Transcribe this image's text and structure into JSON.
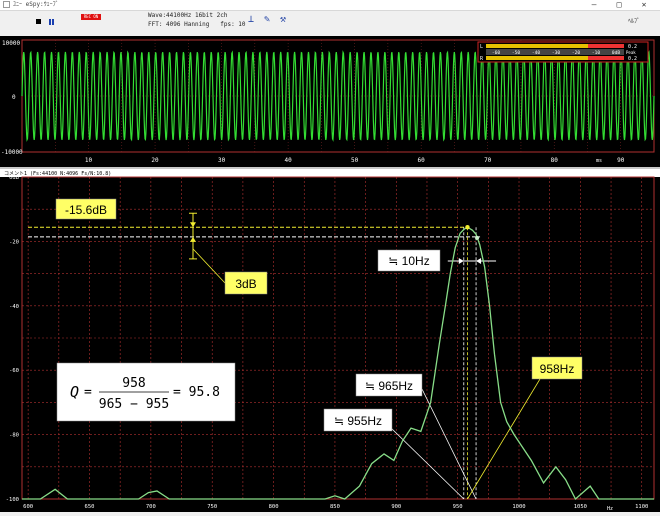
{
  "window": {
    "title": "ﾕﾆｰ eSpy:ｳｪｰﾌﾞ",
    "min_label": "—",
    "max_label": "□",
    "close_label": "✕"
  },
  "toolbar": {
    "record_label": "REC ON",
    "wave_info": "Wave:44100Hz 16bit 2ch",
    "fft_info": "FFT: 4096 Hanning   fps: 10",
    "tool1_icon": "bars-icon",
    "tool2_icon": "pen-icon",
    "tool3_icon": "wrench-icon",
    "right_label": "ﾍﾙﾌﾟ"
  },
  "waveform": {
    "y_ticks": [
      "10000",
      "0",
      "-10000"
    ],
    "x_ticks": [
      "10",
      "20",
      "30",
      "40",
      "50",
      "60",
      "70",
      "80",
      "90"
    ],
    "x_unit": "ms",
    "line_color": "#33dd33",
    "meter": {
      "left_label": "L",
      "right_label": "R",
      "scale": [
        "-60",
        "-50",
        "-40",
        "-30",
        "-20",
        "-10",
        "0dB"
      ],
      "peak_label": "Peak",
      "left_value": "0.2",
      "right_value": "0.2"
    }
  },
  "spectrum": {
    "header": "コメント1   (Fs:44100 N:4096 Fs/N:10.8)",
    "y_ticks": [
      "0dB",
      "-20",
      "-40",
      "-60",
      "-80",
      "-100"
    ],
    "x_ticks": [
      "600",
      "650",
      "700",
      "750",
      "800",
      "850",
      "900",
      "950",
      "1000",
      "1050",
      "1100"
    ],
    "x_unit": "Hz",
    "line_color": "#88dd88",
    "grid_color": "#b03030"
  },
  "chart_data": {
    "type": "line",
    "xlabel": "Hz",
    "ylabel": "",
    "xlim": [
      595,
      1110
    ],
    "ylim": [
      -100,
      0
    ],
    "series": [
      {
        "x": [
          595,
          610,
          622,
          632,
          690,
          698,
          705,
          715,
          735,
          770,
          790,
          842,
          850,
          858,
          870,
          880,
          890,
          898,
          905,
          912,
          920,
          928,
          935,
          940,
          944,
          948,
          952,
          955,
          958,
          962,
          965,
          968,
          972,
          976,
          980,
          985,
          990,
          996,
          1003,
          1010,
          1020,
          1030,
          1038,
          1046,
          1058,
          1065,
          1080,
          1095,
          1110
        ],
        "y": [
          -100,
          -100,
          -97,
          -100,
          -100,
          -98,
          -97.5,
          -100,
          -100,
          -100,
          -100,
          -100,
          -99,
          -100,
          -96,
          -89,
          -86,
          -88,
          -82,
          -78,
          -79,
          -70,
          -52,
          -40,
          -30,
          -22,
          -17.5,
          -16.3,
          -15.6,
          -16.5,
          -17.8,
          -21,
          -28,
          -40,
          -55,
          -70,
          -76,
          -80,
          -84,
          -88,
          -95,
          -90,
          -94,
          -100,
          -96,
          -100,
          -100,
          -100,
          -100
        ]
      }
    ],
    "annotations": {
      "peak_level": "-15.6dB",
      "bandwidth_drop": "3dB",
      "bandwidth": "≒ 10Hz",
      "upper_freq": "≒ 965Hz",
      "lower_freq": "≒ 955Hz",
      "center_freq": "958Hz",
      "q_label": "Q",
      "q_equals": "=",
      "q_numerator": "958",
      "q_denominator": "965 − 955",
      "q_result": "= 95.8"
    }
  }
}
